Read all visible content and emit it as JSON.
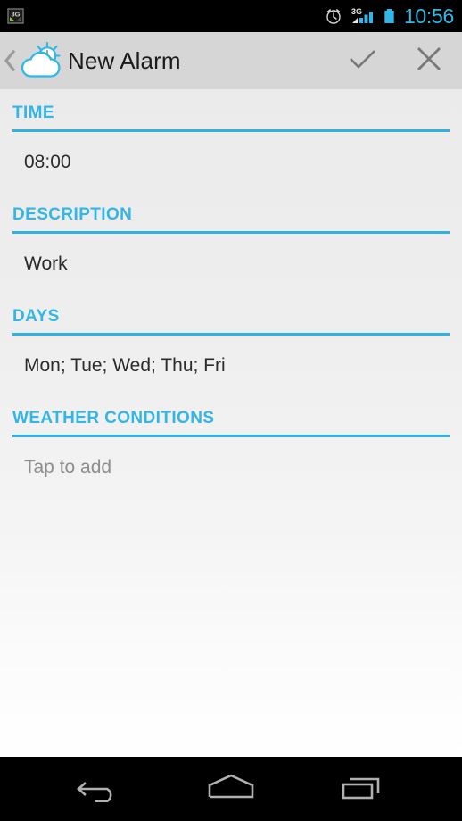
{
  "status_bar": {
    "data_icon": "3g-data-icon",
    "data_icon_label": "3G",
    "alarm_icon": "alarm-clock-icon",
    "network_icon": "signal-3g-icon",
    "network_label": "3G",
    "battery_icon": "battery-full-icon",
    "clock": "10:56",
    "clock_color": "#34b6e4",
    "background": "#000000"
  },
  "action_bar": {
    "up_icon": "back-chevron-icon",
    "app_icon": "weather-alarm-icon",
    "title": "New Alarm",
    "done_icon": "checkmark-icon",
    "done_label": "Done",
    "cancel_icon": "close-x-icon",
    "cancel_label": "Cancel",
    "background": "#d6d6d6",
    "title_color": "#1b1b1b"
  },
  "theme": {
    "accent": "#33b5e5",
    "rule": "#2fb2e3",
    "value_text": "#2b2b2b",
    "placeholder_text": "#8d8d8d"
  },
  "sections": [
    {
      "header": "TIME",
      "value": "08:00",
      "is_placeholder": false
    },
    {
      "header": "DESCRIPTION",
      "value": "Work",
      "is_placeholder": false
    },
    {
      "header": "DAYS",
      "value": "Mon; Tue; Wed; Thu; Fri",
      "is_placeholder": false
    },
    {
      "header": "WEATHER CONDITIONS",
      "value": "Tap to add",
      "is_placeholder": true
    }
  ],
  "nav_bar": {
    "back_icon": "back-arrow-icon",
    "back_label": "Back",
    "home_icon": "home-icon",
    "home_label": "Home",
    "recents_icon": "recent-apps-icon",
    "recents_label": "Recent apps",
    "background": "#000000"
  }
}
